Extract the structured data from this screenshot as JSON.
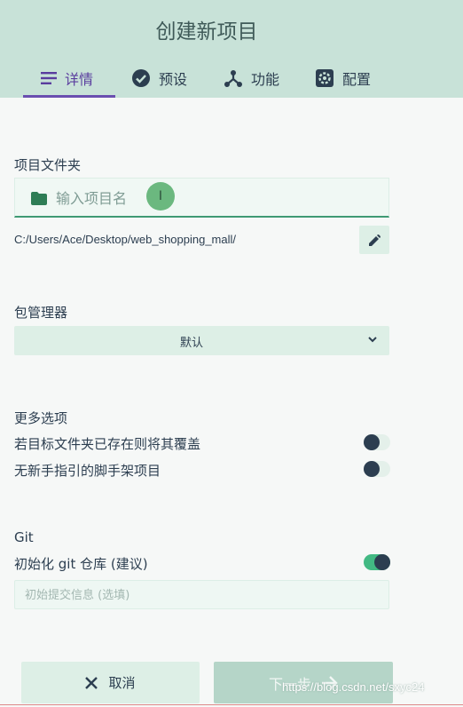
{
  "header": {
    "title": "创建新项目"
  },
  "tabs": [
    {
      "label": "详情",
      "icon": "list-icon",
      "active": true
    },
    {
      "label": "预设",
      "icon": "check-circle-icon",
      "active": false
    },
    {
      "label": "功能",
      "icon": "fork-icon",
      "active": false
    },
    {
      "label": "配置",
      "icon": "settings-icon",
      "active": false
    }
  ],
  "folder": {
    "label": "项目文件夹",
    "placeholder": "输入项目名",
    "path": "C:/Users/Ace/Desktop/web_shopping_mall/"
  },
  "package_manager": {
    "label": "包管理器",
    "value": "默认"
  },
  "more_options": {
    "label": "更多选项",
    "items": [
      {
        "label": "若目标文件夹已存在则将其覆盖",
        "on": false
      },
      {
        "label": "无新手指引的脚手架项目",
        "on": false
      }
    ]
  },
  "git": {
    "label": "Git",
    "init_label": "初始化 git 仓库 (建议)",
    "init_on": true,
    "commit_placeholder": "初始提交信息 (选填)"
  },
  "footer": {
    "cancel_label": "取消",
    "next_label": "下一步"
  },
  "watermark": "https://blog.csdn.net/sxyc24",
  "colors": {
    "accent": "#42b983",
    "header_bg": "#c8e2d8",
    "active_tab": "#5a3d9e"
  }
}
